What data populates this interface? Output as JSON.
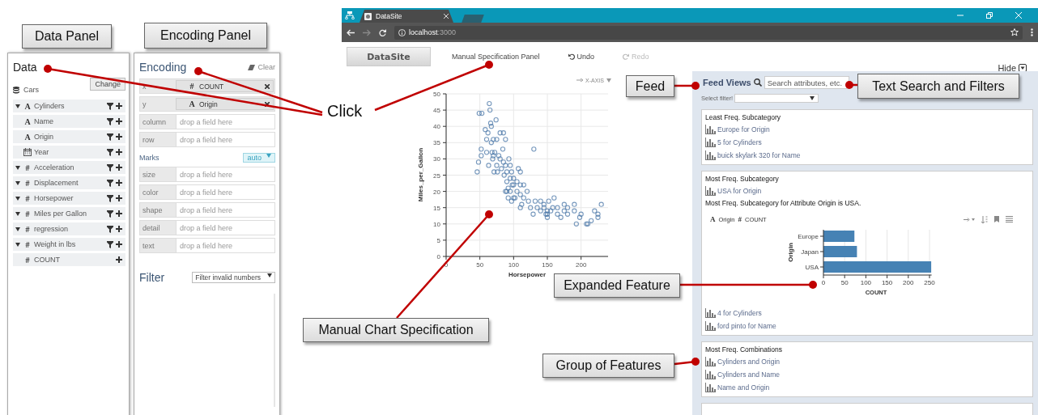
{
  "callouts": [
    {
      "label": "Data Panel"
    },
    {
      "label": "Encoding Panel"
    },
    {
      "label": "Feed"
    },
    {
      "label": "Text Search and Filters"
    },
    {
      "label": "Expanded Feature"
    },
    {
      "label": "Manual Chart Specification"
    },
    {
      "label": "Group of Features"
    }
  ],
  "click_label": "Click",
  "data_panel": {
    "title": "Data",
    "change_button": "Change",
    "dataset": "Cars",
    "fields": [
      {
        "name": "Cylinders",
        "kind": "nominal",
        "glyph": "A",
        "expandable": true,
        "filter": true
      },
      {
        "name": "Name",
        "kind": "nominal",
        "glyph": "A",
        "expandable": false,
        "filter": true
      },
      {
        "name": "Origin",
        "kind": "nominal",
        "glyph": "A",
        "expandable": false,
        "filter": true
      },
      {
        "name": "Year",
        "kind": "temporal",
        "expandable": false,
        "filter": true
      },
      {
        "name": "Acceleration",
        "kind": "quantitative",
        "glyph": "#",
        "expandable": true,
        "filter": true
      },
      {
        "name": "Displacement",
        "kind": "quantitative",
        "glyph": "#",
        "expandable": true,
        "filter": true
      },
      {
        "name": "Horsepower",
        "kind": "quantitative",
        "glyph": "#",
        "expandable": true,
        "filter": true
      },
      {
        "name": "Miles per Gallon",
        "kind": "quantitative",
        "glyph": "#",
        "expandable": true,
        "filter": true
      },
      {
        "name": "regression",
        "kind": "quantitative",
        "glyph": "#",
        "expandable": true,
        "filter": true
      },
      {
        "name": "Weight in lbs",
        "kind": "quantitative",
        "glyph": "#",
        "expandable": true,
        "filter": true
      },
      {
        "name": "COUNT",
        "kind": "quantitative",
        "glyph": "#",
        "expandable": false,
        "filter": false
      }
    ]
  },
  "encoding_panel": {
    "title": "Encoding",
    "clear": "Clear",
    "shelves": [
      {
        "channel": "x",
        "field": "COUNT",
        "glyph": "#"
      },
      {
        "channel": "y",
        "field": "Origin",
        "glyph": "A"
      },
      {
        "channel": "column",
        "placeholder": "drop a field here"
      },
      {
        "channel": "row",
        "placeholder": "drop a field here"
      }
    ],
    "marks_label": "Marks",
    "mark_select": "auto",
    "mark_shelves": [
      {
        "channel": "size",
        "placeholder": "drop a field here"
      },
      {
        "channel": "color",
        "placeholder": "drop a field here"
      },
      {
        "channel": "shape",
        "placeholder": "drop a field here"
      },
      {
        "channel": "detail",
        "placeholder": "drop a field here"
      },
      {
        "channel": "text",
        "placeholder": "drop a field here"
      }
    ],
    "filter_title": "Filter",
    "filter_select": "Filter invalid numbers"
  },
  "browser": {
    "tab_title": "DataSite",
    "url_host": "localhost",
    "url_port": ":3000"
  },
  "app": {
    "logo": "DataSite",
    "nav": [
      {
        "label": "Manual Specification Panel",
        "kind": "link",
        "disabled": false
      },
      {
        "label": "Undo",
        "kind": "undo",
        "disabled": false
      },
      {
        "label": "Redo",
        "kind": "redo",
        "disabled": true
      }
    ],
    "hide": "Hide"
  },
  "chart_toolbar": {
    "x_axis": "X-AXIS"
  },
  "scatter": {
    "chart_data": {
      "type": "scatter",
      "xlabel": "Horsepower",
      "ylabel": "Miles_per_Gallon",
      "x": [
        46,
        48,
        52,
        52,
        49,
        53,
        58,
        60,
        62,
        64,
        65,
        66,
        67,
        68,
        69,
        70,
        70,
        71,
        72,
        74,
        75,
        75,
        76,
        78,
        80,
        80,
        82,
        84,
        85,
        86,
        88,
        88,
        90,
        90,
        90,
        92,
        92,
        95,
        95,
        95,
        97,
        98,
        100,
        100,
        102,
        105,
        105,
        107,
        110,
        110,
        110,
        112,
        115,
        115,
        120,
        122,
        125,
        129,
        130,
        132,
        135,
        140,
        140,
        145,
        145,
        148,
        150,
        150,
        150,
        152,
        155,
        158,
        160,
        165,
        165,
        170,
        175,
        175,
        180,
        180,
        190,
        190,
        193,
        198,
        200,
        208,
        210,
        215,
        220,
        225,
        225,
        230,
        60,
        67,
        63,
        85,
        88,
        93,
        97,
        110,
        100
      ],
      "series": [
        {
          "color": "#4c78a8",
          "values": [
            26,
            29,
            33,
            31,
            44,
            44,
            39,
            36,
            38,
            47,
            45,
            41,
            35,
            32,
            30,
            36,
            31,
            26,
            32,
            42,
            36,
            28,
            26,
            31,
            38,
            30,
            27,
            33,
            29,
            25,
            36,
            28,
            26,
            20,
            23,
            21,
            18,
            28,
            24,
            20,
            26,
            22,
            18,
            24,
            18,
            23,
            20,
            27,
            26,
            19,
            22,
            16,
            22,
            18,
            20,
            17,
            15,
            13,
            33,
            17,
            15,
            17,
            14,
            15,
            16,
            13,
            14,
            12,
            13,
            17,
            14,
            15,
            18,
            13,
            15,
            12,
            14,
            16,
            13,
            15,
            14,
            16,
            10,
            12,
            13,
            10,
            10,
            11,
            14,
            13,
            12,
            16,
            32,
            40,
            28,
            38,
            20,
            30,
            17,
            15,
            22
          ]
        }
      ],
      "grid": true,
      "xlim": [
        0,
        240
      ],
      "ylim": [
        0,
        50
      ],
      "xticks": [
        0,
        50,
        100,
        150,
        200
      ],
      "yticks": [
        0,
        5,
        10,
        15,
        20,
        25,
        30,
        35,
        40,
        45,
        50
      ]
    }
  },
  "feed": {
    "title": "Feed Views",
    "search_placeholder": "Search attributes, etc.",
    "filter_label": "Select filter!",
    "groups": [
      {
        "title": "Least Freq. Subcategory",
        "items": [
          {
            "label": "Europe for Origin"
          },
          {
            "label": "5 for Cylinders"
          },
          {
            "label": "buick skylark 320 for Name"
          }
        ]
      },
      {
        "title": "Most Freq. Subcategory",
        "items": [
          {
            "label": "USA for Origin"
          }
        ],
        "description": "Most Freq. Subcategory for Attribute Origin is USA.",
        "expanded": {
          "fields": [
            {
              "glyph": "A",
              "name": "Origin"
            },
            {
              "glyph": "#",
              "name": "COUNT"
            }
          ],
          "chart_data": {
            "type": "bar",
            "orientation": "horizontal",
            "xlabel": "COUNT",
            "ylabel": "Origin",
            "categories": [
              "Europe",
              "Japan",
              "USA"
            ],
            "series": [
              {
                "color": "#4682b4",
                "values": [
                  73,
                  79,
                  254
                ]
              }
            ],
            "grid": true,
            "xlim": [
              0,
              255
            ],
            "xticks": [
              0,
              50,
              100,
              150,
              200,
              250
            ]
          }
        },
        "more_items": [
          {
            "label": "4 for Cylinders"
          },
          {
            "label": "ford pinto for Name"
          }
        ]
      },
      {
        "title": "Most Freq. Combinations",
        "items": [
          {
            "label": "Cylinders and Origin"
          },
          {
            "label": "Cylinders and Name"
          },
          {
            "label": "Name and Origin"
          }
        ]
      }
    ]
  }
}
